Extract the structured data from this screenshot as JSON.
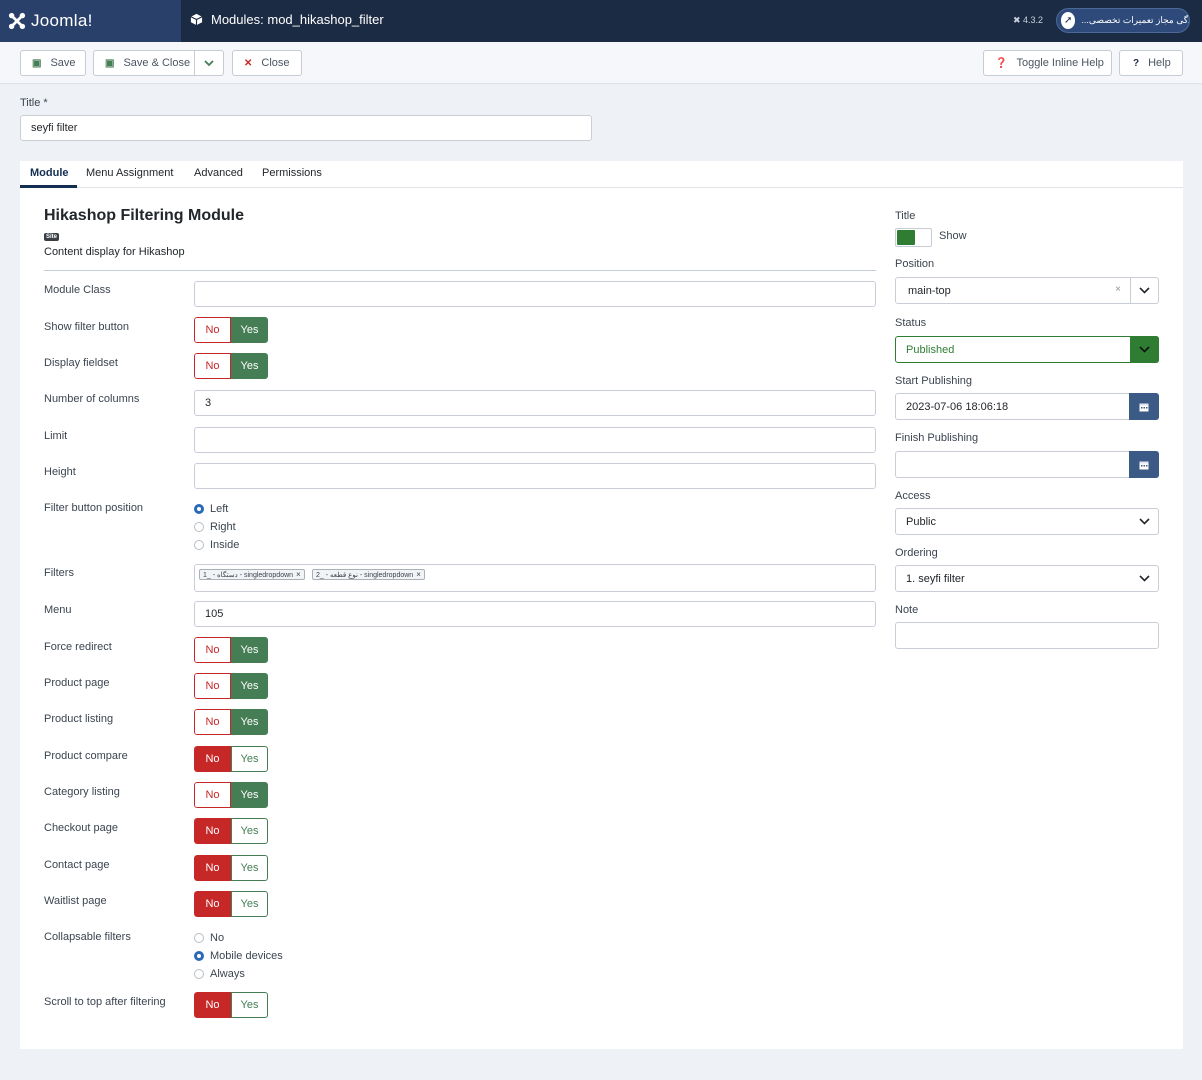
{
  "header": {
    "brand": "Joomla!",
    "page_title": "Modules: mod_hikashop_filter",
    "version": "4.3.2",
    "site_link": "...نمایندگی مجاز تعمیرات تخصصی"
  },
  "toolbar": {
    "save": "Save",
    "save_close": "Save & Close",
    "close": "Close",
    "toggle_help": "Toggle Inline Help",
    "help": "Help"
  },
  "title_field": {
    "label": "Title *",
    "value": "seyfi filter"
  },
  "tabs": [
    "Module",
    "Menu Assignment",
    "Advanced",
    "Permissions"
  ],
  "module": {
    "heading": "Hikashop Filtering Module",
    "badge": "Site",
    "description": "Content display for Hikashop"
  },
  "form": {
    "module_class": {
      "label": "Module Class",
      "value": ""
    },
    "show_filter_button": {
      "label": "Show filter button",
      "value": "Yes"
    },
    "display_fieldset": {
      "label": "Display fieldset",
      "value": "Yes"
    },
    "number_of_columns": {
      "label": "Number of columns",
      "value": "3"
    },
    "limit": {
      "label": "Limit",
      "value": ""
    },
    "height": {
      "label": "Height",
      "value": ""
    },
    "filter_button_position": {
      "label": "Filter button position",
      "options": [
        "Left",
        "Right",
        "Inside"
      ],
      "value": "Left"
    },
    "filters": {
      "label": "Filters",
      "chips": [
        "1_ - دستگاه - singledropdown",
        "2_ - نوع قطعه - singledropdown"
      ]
    },
    "menu": {
      "label": "Menu",
      "value": "105"
    },
    "force_redirect": {
      "label": "Force redirect",
      "value": "Yes"
    },
    "product_page": {
      "label": "Product page",
      "value": "Yes"
    },
    "product_listing": {
      "label": "Product listing",
      "value": "Yes"
    },
    "product_compare": {
      "label": "Product compare",
      "value": "No"
    },
    "category_listing": {
      "label": "Category listing",
      "value": "Yes"
    },
    "checkout_page": {
      "label": "Checkout page",
      "value": "No"
    },
    "contact_page": {
      "label": "Contact page",
      "value": "No"
    },
    "waitlist_page": {
      "label": "Waitlist page",
      "value": "No"
    },
    "collapsable_filters": {
      "label": "Collapsable filters",
      "options": [
        "No",
        "Mobile devices",
        "Always"
      ],
      "value": "Mobile devices"
    },
    "scroll_to_top": {
      "label": "Scroll to top after filtering",
      "value": "No"
    },
    "no_label": "No",
    "yes_label": "Yes"
  },
  "sidebar": {
    "title": {
      "label": "Title",
      "toggle_text": "Show"
    },
    "position": {
      "label": "Position",
      "value": "main-top"
    },
    "status": {
      "label": "Status",
      "value": "Published"
    },
    "start_publishing": {
      "label": "Start Publishing",
      "value": "2023-07-06 18:06:18"
    },
    "finish_publishing": {
      "label": "Finish Publishing",
      "value": ""
    },
    "access": {
      "label": "Access",
      "value": "Public"
    },
    "ordering": {
      "label": "Ordering",
      "value": "1. seyfi filter"
    },
    "note": {
      "label": "Note",
      "value": ""
    }
  },
  "colors": {
    "header_bg": "#1c2b44",
    "brand_bg": "#29416a",
    "yes_green": "#457d54",
    "no_red": "#c52827",
    "status_green": "#2e7d32"
  }
}
